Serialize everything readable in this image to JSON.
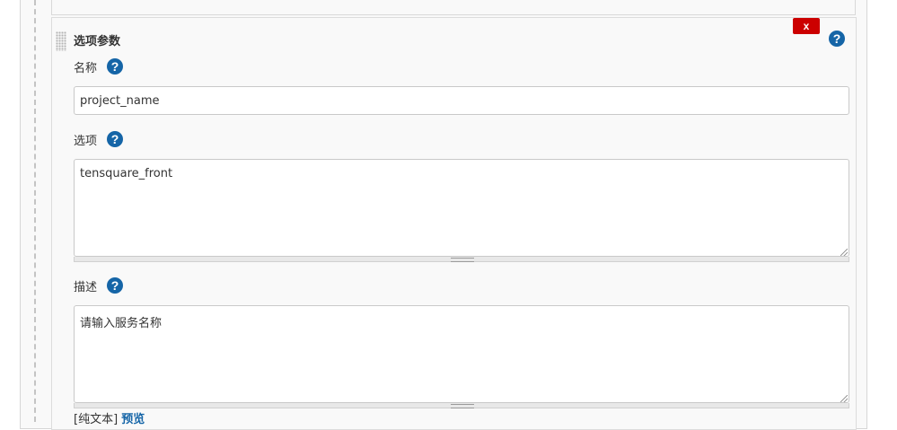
{
  "choice_param": {
    "section_title": "选项参数",
    "delete_label": "x",
    "help_glyph": "?",
    "name": {
      "label": "名称",
      "value": "project_name"
    },
    "choices": {
      "label": "选项",
      "value": "tensquare_front"
    },
    "description": {
      "label": "描述",
      "value": "请输入服务名称"
    },
    "footer": {
      "syntax_text": "[纯文本]",
      "preview_link": "预览"
    }
  },
  "colors": {
    "accent": "#1565a7",
    "danger": "#cc0000",
    "panel_bg": "#f9f9f9"
  },
  "icons": [
    "help-icon",
    "drag-handle-icon",
    "close-icon",
    "resize-grip-icon"
  ]
}
